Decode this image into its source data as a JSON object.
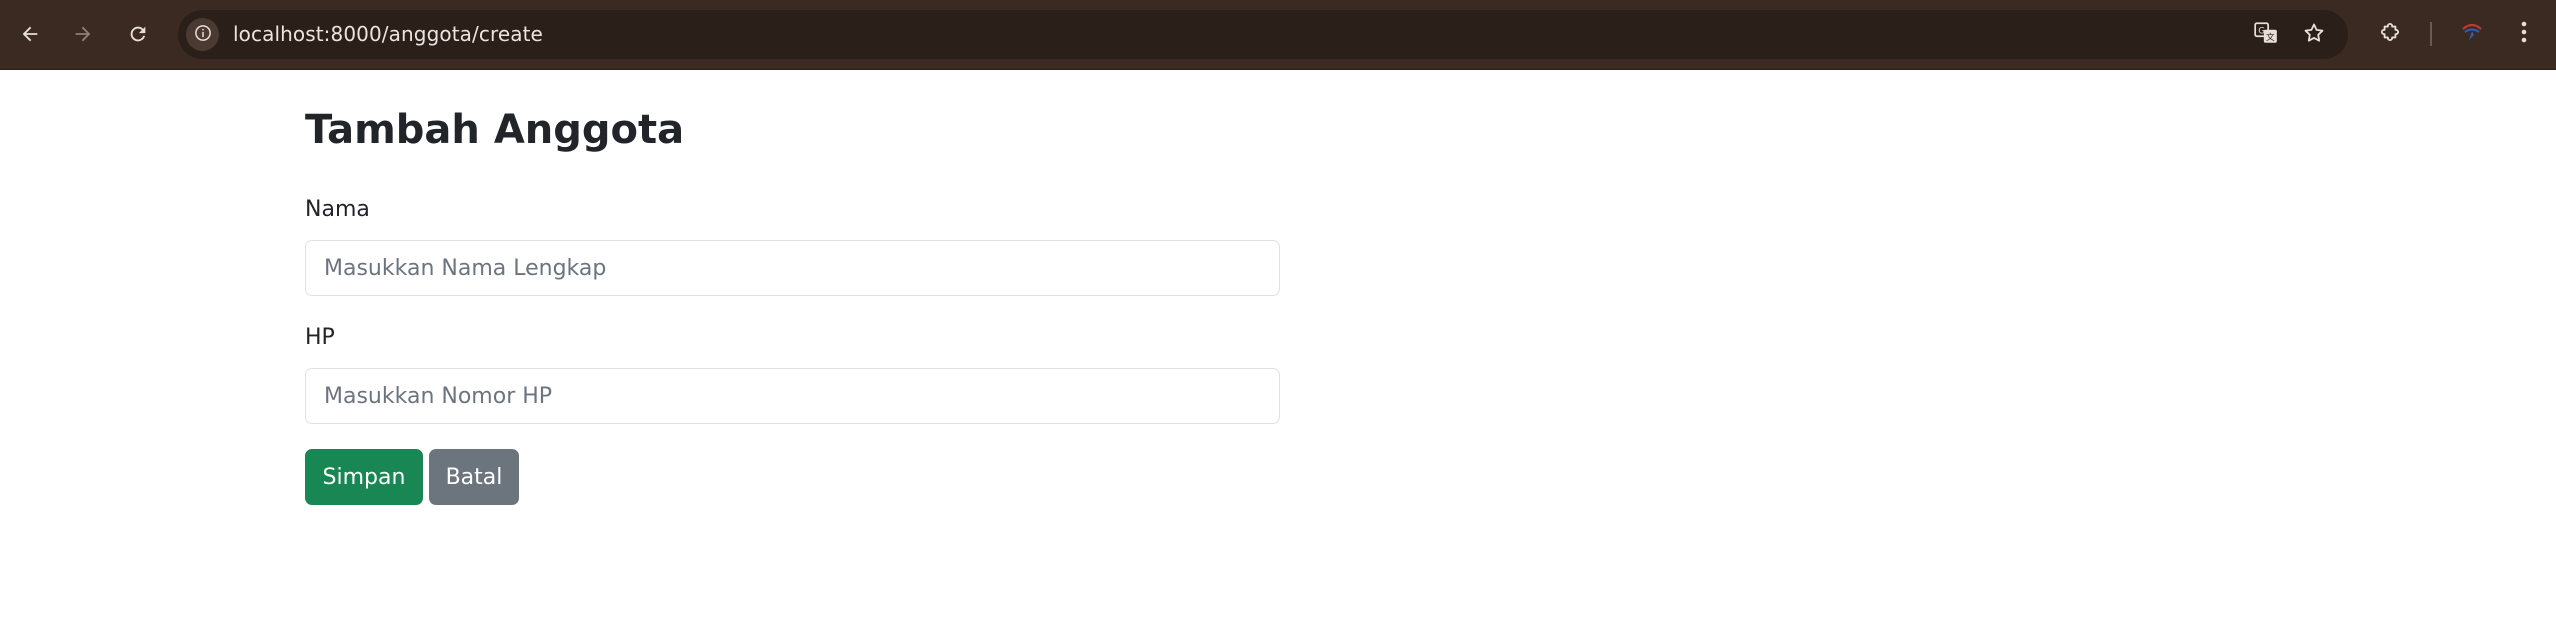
{
  "browser": {
    "url": "localhost:8000/anggota/create",
    "colors": {
      "toolbar": "#3a2a22",
      "omnibox": "#2a1f19",
      "icon": "#e8dfd9"
    },
    "icons": {
      "back": "arrow-left-icon",
      "forward": "arrow-right-icon",
      "reload": "reload-icon",
      "site_info": "info-icon",
      "translate": "translate-icon",
      "bookmark": "star-icon",
      "extensions": "puzzle-icon",
      "profile": "profile-avatar-icon",
      "menu": "kebab-menu-icon"
    }
  },
  "page": {
    "title": "Tambah Anggota",
    "form": {
      "nama": {
        "label": "Nama",
        "value": "",
        "placeholder": "Masukkan Nama Lengkap"
      },
      "hp": {
        "label": "HP",
        "value": "",
        "placeholder": "Masukkan Nomor HP"
      }
    },
    "buttons": {
      "save_label": "Simpan",
      "cancel_label": "Batal"
    },
    "colors": {
      "save": "#198754",
      "cancel": "#6c757d",
      "text": "#212529",
      "placeholder": "#6c757d",
      "border": "#dee2e6"
    }
  }
}
